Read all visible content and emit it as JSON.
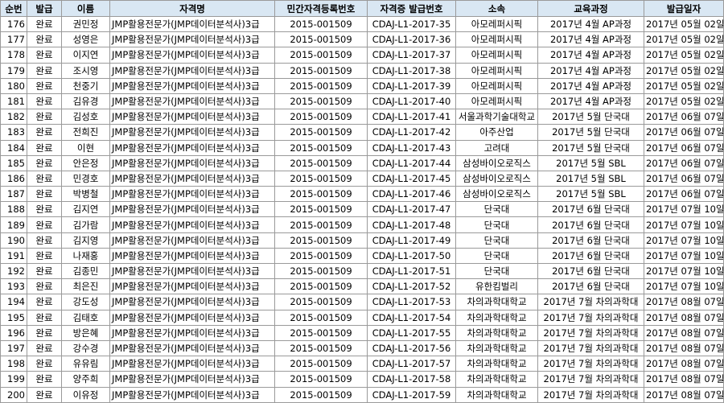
{
  "headers": [
    "순번",
    "발급",
    "이름",
    "자격명",
    "민간자격등록번호",
    "자격증 발급번호",
    "소속",
    "교육과정",
    "발급일자"
  ],
  "rows": [
    [
      "176",
      "완료",
      "권민정",
      "JMP활용전문가(JMP데이터분석사)3급",
      "2015-001509",
      "CDAJ-L1-2017-35",
      "아모레퍼시픽",
      "2017년 4월 AP과정",
      "2017년 05월 02일"
    ],
    [
      "177",
      "완료",
      "성영은",
      "JMP활용전문가(JMP데이터분석사)3급",
      "2015-001509",
      "CDAJ-L1-2017-36",
      "아모레퍼시픽",
      "2017년 4월 AP과정",
      "2017년 05월 02일"
    ],
    [
      "178",
      "완료",
      "이지연",
      "JMP활용전문가(JMP데이터분석사)3급",
      "2015-001509",
      "CDAJ-L1-2017-37",
      "아모레퍼시픽",
      "2017년 4월 AP과정",
      "2017년 05월 02일"
    ],
    [
      "179",
      "완료",
      "조시영",
      "JMP활용전문가(JMP데이터분석사)3급",
      "2015-001509",
      "CDAJ-L1-2017-38",
      "아모레퍼시픽",
      "2017년 4월 AP과정",
      "2017년 05월 02일"
    ],
    [
      "180",
      "완료",
      "천중기",
      "JMP활용전문가(JMP데이터분석사)3급",
      "2015-001509",
      "CDAJ-L1-2017-39",
      "아모레퍼시픽",
      "2017년 4월 AP과정",
      "2017년 05월 02일"
    ],
    [
      "181",
      "완료",
      "김유경",
      "JMP활용전문가(JMP데이터분석사)3급",
      "2015-001509",
      "CDAJ-L1-2017-40",
      "아모레퍼시픽",
      "2017년 4월 AP과정",
      "2017년 05월 02일"
    ],
    [
      "182",
      "완료",
      "김성호",
      "JMP활용전문가(JMP데이터분석사)3급",
      "2015-001509",
      "CDAJ-L1-2017-41",
      "서울과학기술대학교",
      "2017년 5월 단국대",
      "2017년 06월 07일"
    ],
    [
      "183",
      "완료",
      "전희진",
      "JMP활용전문가(JMP데이터분석사)3급",
      "2015-001509",
      "CDAJ-L1-2017-42",
      "아주산업",
      "2017년 5월 단국대",
      "2017년 06월 07일"
    ],
    [
      "184",
      "완료",
      "이현",
      "JMP활용전문가(JMP데이터분석사)3급",
      "2015-001509",
      "CDAJ-L1-2017-43",
      "고려대",
      "2017년 5월 단국대",
      "2017년 06월 07일"
    ],
    [
      "185",
      "완료",
      "안은정",
      "JMP활용전문가(JMP데이터분석사)3급",
      "2015-001509",
      "CDAJ-L1-2017-44",
      "삼성바이오로직스",
      "2017년 5월 SBL",
      "2017년 06월 07일"
    ],
    [
      "186",
      "완료",
      "민경호",
      "JMP활용전문가(JMP데이터분석사)3급",
      "2015-001509",
      "CDAJ-L1-2017-45",
      "삼성바이오로직스",
      "2017년 5월 SBL",
      "2017년 06월 07일"
    ],
    [
      "187",
      "완료",
      "박병철",
      "JMP활용전문가(JMP데이터분석사)3급",
      "2015-001509",
      "CDAJ-L1-2017-46",
      "삼성바이오로직스",
      "2017년 5월 SBL",
      "2017년 06월 07일"
    ],
    [
      "188",
      "완료",
      "김지연",
      "JMP활용전문가(JMP데이터분석사)3급",
      "2015-001509",
      "CDAJ-L1-2017-47",
      "단국대",
      "2017년 6월 단국대",
      "2017년 07월 10일"
    ],
    [
      "189",
      "완료",
      "김가람",
      "JMP활용전문가(JMP데이터분석사)3급",
      "2015-001509",
      "CDAJ-L1-2017-48",
      "단국대",
      "2017년 6월 단국대",
      "2017년 07월 10일"
    ],
    [
      "190",
      "완료",
      "김지영",
      "JMP활용전문가(JMP데이터분석사)3급",
      "2015-001509",
      "CDAJ-L1-2017-49",
      "단국대",
      "2017년 6월 단국대",
      "2017년 07월 10일"
    ],
    [
      "191",
      "완료",
      "나재홍",
      "JMP활용전문가(JMP데이터분석사)3급",
      "2015-001509",
      "CDAJ-L1-2017-50",
      "단국대",
      "2017년 6월 단국대",
      "2017년 07월 10일"
    ],
    [
      "192",
      "완료",
      "김종민",
      "JMP활용전문가(JMP데이터분석사)3급",
      "2015-001509",
      "CDAJ-L1-2017-51",
      "단국대",
      "2017년 6월 단국대",
      "2017년 07월 10일"
    ],
    [
      "193",
      "완료",
      "최은진",
      "JMP활용전문가(JMP데이터분석사)3급",
      "2015-001509",
      "CDAJ-L1-2017-52",
      "유한킴벌리",
      "2017년 6월 단국대",
      "2017년 07월 10일"
    ],
    [
      "194",
      "완료",
      "강도성",
      "JMP활용전문가(JMP데이터분석사)3급",
      "2015-001509",
      "CDAJ-L1-2017-53",
      "차의과학대학교",
      "2017년 7월 차의과학대",
      "2017년 08월 07일"
    ],
    [
      "195",
      "완료",
      "김태호",
      "JMP활용전문가(JMP데이터분석사)3급",
      "2015-001509",
      "CDAJ-L1-2017-54",
      "차의과학대학교",
      "2017년 7월 차의과학대",
      "2017년 08월 07일"
    ],
    [
      "196",
      "완료",
      "방은혜",
      "JMP활용전문가(JMP데이터분석사)3급",
      "2015-001509",
      "CDAJ-L1-2017-55",
      "차의과학대학교",
      "2017년 7월 차의과학대",
      "2017년 08월 07일"
    ],
    [
      "197",
      "완료",
      "강수경",
      "JMP활용전문가(JMP데이터분석사)3급",
      "2015-001509",
      "CDAJ-L1-2017-56",
      "차의과학대학교",
      "2017년 7월 차의과학대",
      "2017년 08월 07일"
    ],
    [
      "198",
      "완료",
      "유유림",
      "JMP활용전문가(JMP데이터분석사)3급",
      "2015-001509",
      "CDAJ-L1-2017-57",
      "차의과학대학교",
      "2017년 7월 차의과학대",
      "2017년 08월 07일"
    ],
    [
      "199",
      "완료",
      "양주희",
      "JMP활용전문가(JMP데이터분석사)3급",
      "2015-001509",
      "CDAJ-L1-2017-58",
      "차의과학대학교",
      "2017년 7월 차의과학대",
      "2017년 08월 07일"
    ],
    [
      "200",
      "완료",
      "이유정",
      "JMP활용전문가(JMP데이터분석사)3급",
      "2015-001509",
      "CDAJ-L1-2017-59",
      "차의과학대학교",
      "2017년 7월 차의과학대",
      "2017년 08월 07일"
    ]
  ]
}
